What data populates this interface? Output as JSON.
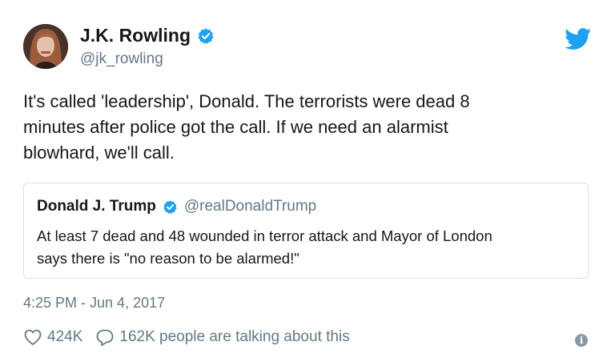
{
  "tweet": {
    "author": {
      "name": "J.K. Rowling",
      "handle": "@jk_rowling",
      "verified": true,
      "avatar_icon": "profile-photo"
    },
    "logo_icon": "twitter-bird-icon",
    "text": "It's called 'leadership', Donald. The terrorists were dead 8\nminutes after police got the call. If we need an alarmist\nblowhard, we'll call.",
    "quoted": {
      "name": "Donald J. Trump",
      "handle": "@realDonaldTrump",
      "verified": true,
      "text": "At least 7 dead and 48 wounded in terror attack and Mayor of London\nsays there is \"no reason to be alarmed!\""
    },
    "timestamp": "4:25 PM - Jun 4, 2017",
    "likes": "424K",
    "replies_text": "162K people are talking about this",
    "info_icon": "info-icon"
  },
  "colors": {
    "accent": "#1da1f2",
    "text": "#14171a",
    "muted": "#657786",
    "border": "#d8dee3"
  }
}
